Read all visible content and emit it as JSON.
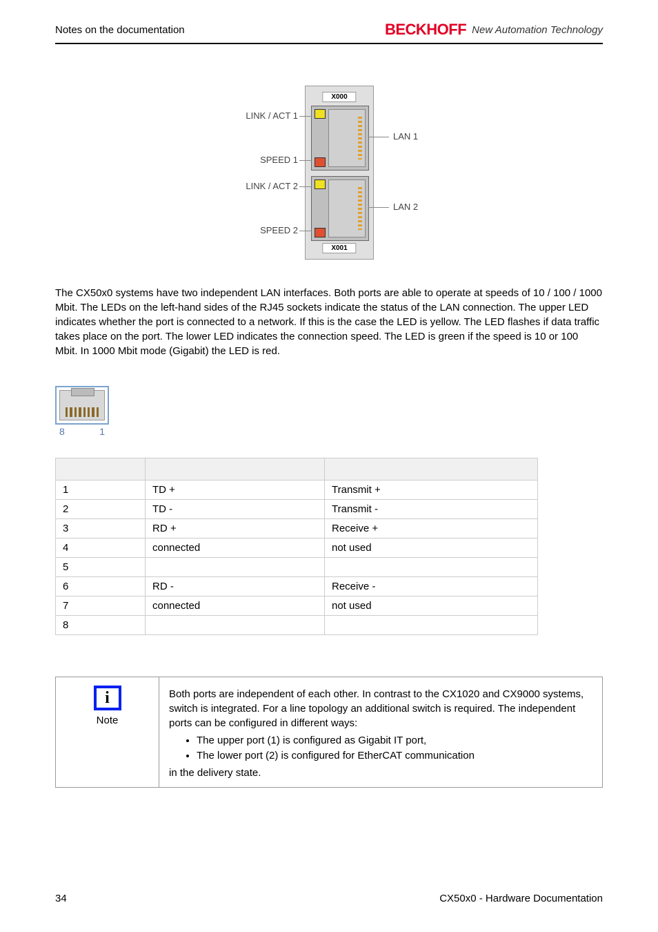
{
  "header": {
    "left": "Notes on the documentation",
    "logo": "BECKHOFF",
    "tagline": "New Automation Technology"
  },
  "figure": {
    "top_label": "X000",
    "bottom_label": "X001",
    "link1": "LINK / ACT 1",
    "speed1": "SPEED 1",
    "link2": "LINK / ACT 2",
    "speed2": "SPEED 2",
    "lan1": "LAN 1",
    "lan2": "LAN 2"
  },
  "paragraph": "The CX50x0 systems have two independent LAN interfaces. Both ports are able to operate at speeds of 10 / 100 / 1000 Mbit. The LEDs on the left-hand sides of the RJ45 sockets indicate the status of the LAN connection. The upper LED indicates whether the port is connected to a network. If this is the case the LED is yellow. The LED flashes if data traffic takes place on the port. The lower LED indicates the connection speed. The LED is green if the speed is 10 or 100 Mbit. In 1000 Mbit mode (Gigabit) the LED is red.",
  "rj45_pins": {
    "left": "8",
    "right": "1"
  },
  "table": {
    "rows": [
      {
        "pin": "1",
        "sig": "TD +",
        "desc": "Transmit +"
      },
      {
        "pin": "2",
        "sig": "TD -",
        "desc": "Transmit -"
      },
      {
        "pin": "3",
        "sig": "RD +",
        "desc": "Receive +"
      },
      {
        "pin": "4",
        "sig": "connected",
        "desc": "not used"
      },
      {
        "pin": "5",
        "sig": "",
        "desc": ""
      },
      {
        "pin": "6",
        "sig": "RD -",
        "desc": "Receive -"
      },
      {
        "pin": "7",
        "sig": "connected",
        "desc": "not used"
      },
      {
        "pin": "8",
        "sig": "",
        "desc": ""
      }
    ]
  },
  "note": {
    "label": "Note",
    "lead": "Both ports are independent of each other. In contrast to the CX1020 and CX9000 systems, switch is integrated. For a line topology an additional switch is required. The independent ports can be configured in different ways:",
    "bullets": [
      "The upper port (1) is configured as Gigabit IT port,",
      "The lower port (2) is configured for EtherCAT communication"
    ],
    "tail": "in the delivery state."
  },
  "footer": {
    "page": "34",
    "doc": "CX50x0 - Hardware Documentation"
  }
}
